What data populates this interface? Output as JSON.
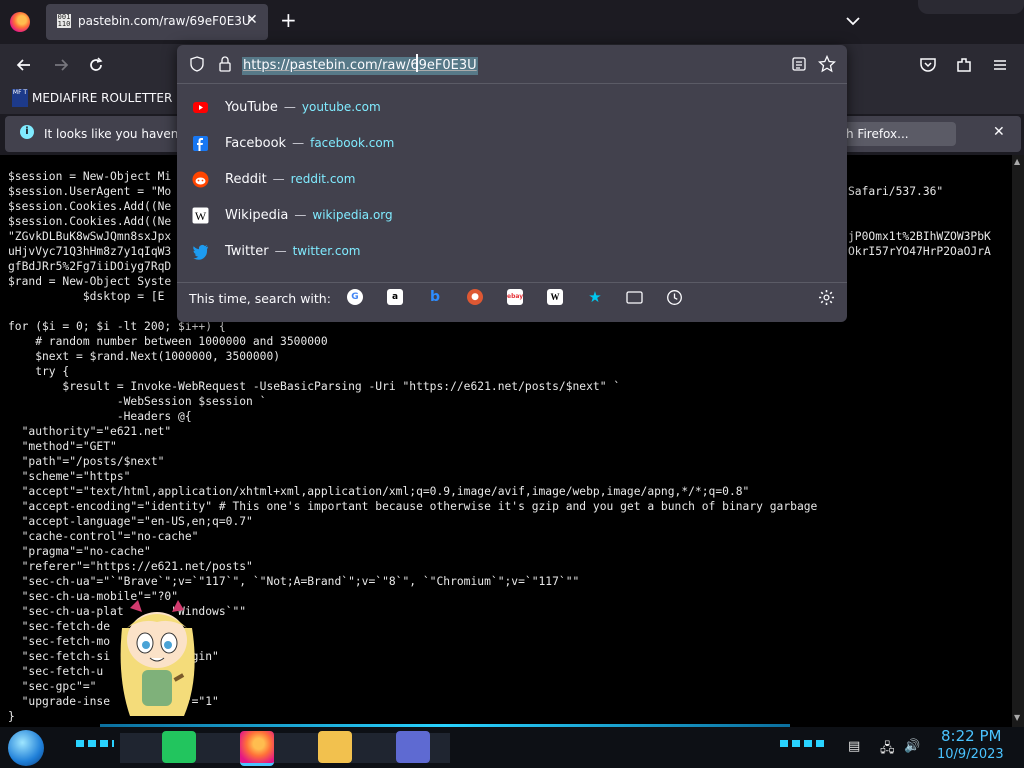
{
  "tab": {
    "favicon_text": "001 110",
    "title": "pastebin.com/raw/69eF0E3U"
  },
  "urlbar": {
    "url": "https://pastebin.com/raw/69eF0E3U"
  },
  "bookmarks": [
    {
      "icon_text": "MF T",
      "label": "MEDIAFIRE ROULETTER"
    }
  ],
  "infobar": {
    "message": "It looks like you haven't s",
    "button_label": "h Firefox..."
  },
  "suggestions": [
    {
      "title": "YouTube",
      "sep": "—",
      "url": "youtube.com",
      "icon": "youtube-icon"
    },
    {
      "title": "Facebook",
      "sep": "—",
      "url": "facebook.com",
      "icon": "facebook-icon"
    },
    {
      "title": "Reddit",
      "sep": "—",
      "url": "reddit.com",
      "icon": "reddit-icon"
    },
    {
      "title": "Wikipedia",
      "sep": "—",
      "url": "wikipedia.org",
      "icon": "wikipedia-icon"
    },
    {
      "title": "Twitter",
      "sep": "—",
      "url": "twitter.com",
      "icon": "twitter-icon"
    }
  ],
  "search_with": {
    "label": "This time, search with:",
    "engines": [
      "google-icon",
      "amazon-icon",
      "bing-icon",
      "duckduckgo-icon",
      "ebay-icon",
      "wikipedia-icon",
      "bookmarks-icon",
      "tabs-icon",
      "history-icon"
    ]
  },
  "code": {
    "left_text": "$session = New-Object Mi\n$session.UserAgent = \"Mo\n$session.Cookies.Add((Ne\n$session.Cookies.Add((Ne\n\"ZGvkDLBuK8wSwJQmn8sxJpx\nuHjvVyc71Q3hHm8z7y1qIqW3\ngfBdJRr5%2Fg7iiDOiyg7RqD\n$rand = New-Object Syste\n           $dsktop = [E\n\nfor ($i = 0; $i -lt 200; $i++) {\n    # random number between 1000000 and 3500000\n    $next = $rand.Next(1000000, 3500000)\n    try {\n        $result = Invoke-WebRequest -UseBasicParsing -Uri \"https://e621.net/posts/$next\" `\n                -WebSession $session `\n                -Headers @{\n  \"authority\"=\"e621.net\"\n  \"method\"=\"GET\"\n  \"path\"=\"/posts/$next\"\n  \"scheme\"=\"https\"\n  \"accept\"=\"text/html,application/xhtml+xml,application/xml;q=0.9,image/avif,image/webp,image/apng,*/*;q=0.8\"\n  \"accept-encoding\"=\"identity\" # This one's important because otherwise it's gzip and you get a bunch of binary garbage\n  \"accept-language\"=\"en-US,en;q=0.7\"\n  \"cache-control\"=\"no-cache\"\n  \"pragma\"=\"no-cache\"\n  \"referer\"=\"https://e621.net/posts\"\n  \"sec-ch-ua\"=\"`\"Brave`\";v=`\"117`\", `\"Not;A=Brand`\";v=`\"8`\", `\"Chromium`\";v=`\"117`\"\"\n  \"sec-ch-ua-mobile\"=\"?0\"\n  \"sec-ch-ua-plat       \"Windows`\"\"\n  \"sec-fetch-de         \"\n  \"sec-fetch-mo         ce\"\n  \"sec-fetch-si         origin\"\n  \"sec-fetch-u\n  \"sec-gpc\"=\"\n  \"upgrade-inse        sts\"=\"1\"\n}",
    "right_line1": "Safari/537.36\"",
    "right_line2": "jP0Omx1t%2BIhWZOW3PbK",
    "right_line3": "OkrI57rYO47HrP2OaOJrA"
  },
  "clock": {
    "time": "8:22 PM",
    "date": "10/9/2023"
  }
}
